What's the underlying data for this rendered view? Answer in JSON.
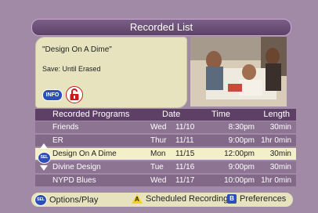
{
  "header": {
    "title": "Recorded List"
  },
  "info": {
    "program_title": "\"Design On A Dime\"",
    "save_status": "Save: Until Erased",
    "info_button": "INFO",
    "lock_icon": "lock-icon"
  },
  "table": {
    "columns": [
      "Recorded Programs",
      "Date",
      "Time",
      "Length"
    ],
    "rows": [
      {
        "program": "Friends",
        "day": "Wed",
        "date": "11/10",
        "time": "8:30pm",
        "length": "30min"
      },
      {
        "program": "ER",
        "day": "Thur",
        "date": "11/11",
        "time": "9:00pm",
        "length": "1hr  0min"
      },
      {
        "program": "Design On A Dime",
        "day": "Mon",
        "date": "11/15",
        "time": "12:00pm",
        "length": "30min"
      },
      {
        "program": "Divine Design",
        "day": "Tue",
        "date": "11/16",
        "time": "9:00pm",
        "length": "30min"
      },
      {
        "program": "NYPD Blues",
        "day": "Wed",
        "date": "11/17",
        "time": "10:00pm",
        "length": "1hr  0min"
      }
    ],
    "selected_index": 2
  },
  "nav": {
    "sel_label": "SEL"
  },
  "footer": {
    "options": {
      "key": "SEL",
      "label": "Options/Play"
    },
    "scheduled": {
      "key": "A",
      "label": "Scheduled Recordings"
    },
    "preferences": {
      "key": "B",
      "label": "Preferences"
    }
  },
  "colors": {
    "background": "#a18aa6",
    "title_bar": "#5d4268",
    "panel": "#e8e3bf",
    "selected_row": "#f2efc9"
  }
}
